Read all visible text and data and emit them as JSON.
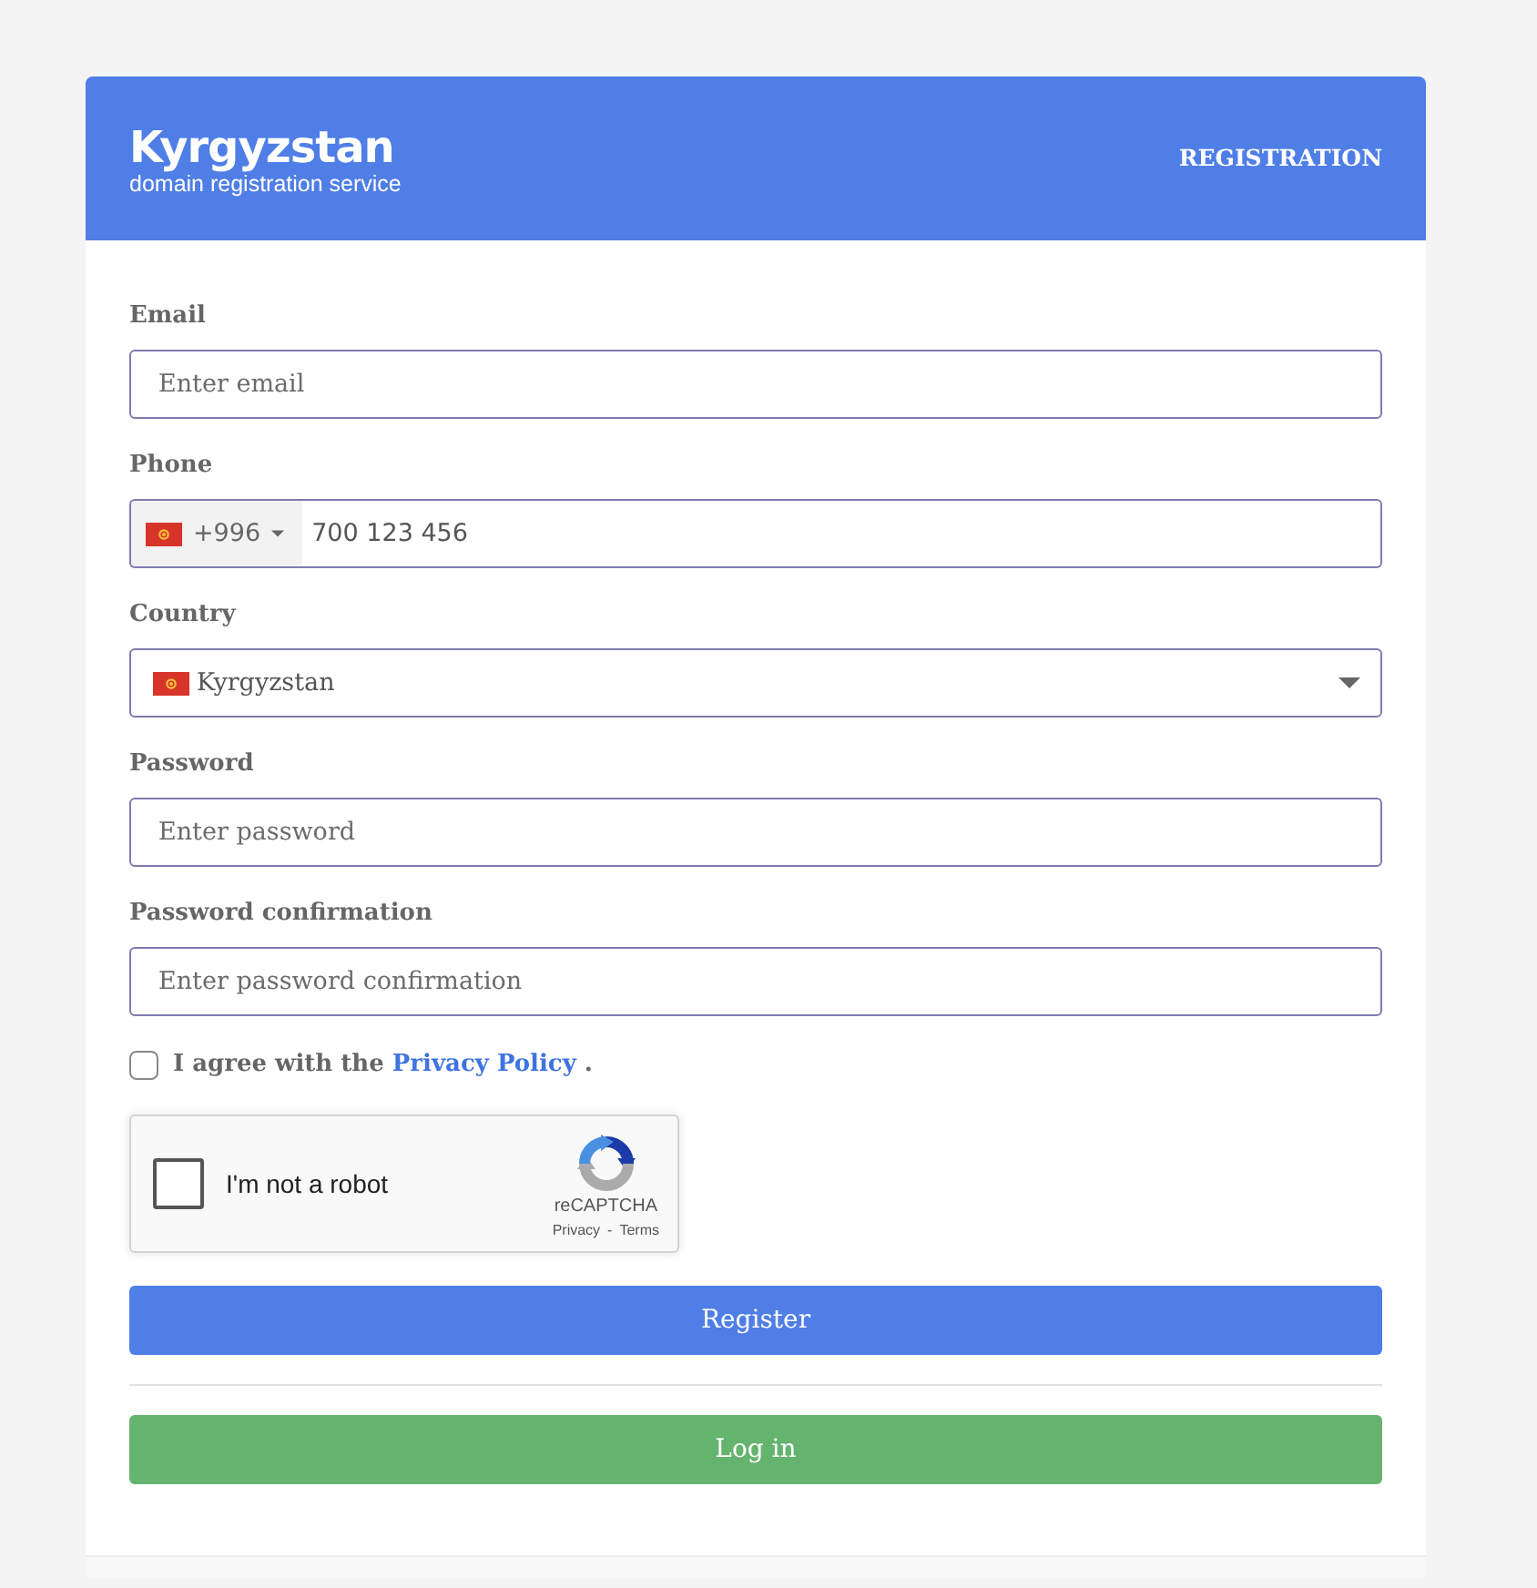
{
  "header": {
    "logo": "Kyrgyzstan",
    "tagline": "domain registration service",
    "title": "REGISTRATION"
  },
  "fields": [
    {
      "kind": "text",
      "label": "Email",
      "placeholder": "Enter email"
    },
    {
      "kind": "phone",
      "label": "Phone",
      "dial_code": "+996",
      "value": "700 123 456"
    },
    {
      "kind": "select",
      "label": "Country",
      "value": "Kyrgyzstan"
    },
    {
      "kind": "text",
      "label": "Password",
      "placeholder": "Enter password"
    },
    {
      "kind": "text",
      "label": "Password confirmation",
      "placeholder": "Enter password confirmation"
    }
  ],
  "agree": {
    "checked": false,
    "text": "I agree with the",
    "link": "Privacy Policy",
    "suffix": "."
  },
  "captcha": {
    "checked": false,
    "label": "I'm not a robot",
    "brand": "reCAPTCHA",
    "links": [
      "Privacy",
      "Terms"
    ],
    "separator": "-"
  },
  "buttons": [
    {
      "kind": "primary",
      "label": "Register"
    },
    {
      "kind": "success",
      "label": "Log in"
    }
  ]
}
